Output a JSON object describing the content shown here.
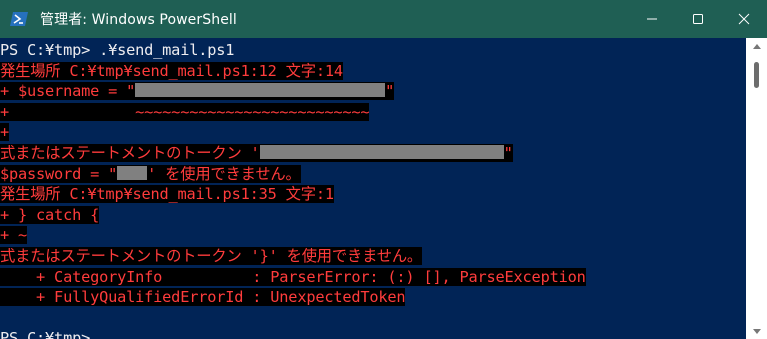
{
  "window": {
    "title": "管理者: Windows PowerShell",
    "icon": "powershell-icon",
    "controls": [
      "minimize-icon",
      "maximize-icon",
      "close-icon"
    ],
    "colors": {
      "titlebar": "#1f5f54",
      "console_bg": "#012456",
      "error_text": "#ff3c3c",
      "error_bg": "#000000"
    }
  },
  "console": {
    "prompt1": "PS C:¥tmp> ",
    "command1": ".¥send_mail.ps1",
    "err1_location": "発生場所 C:¥tmp¥send_mail.ps1:12 文字:14",
    "err1_code_prefix": "+ $username = \"",
    "err1_code_suffix": "\"",
    "err1_squiggle": "+              ~~~~~~~~~~~~~~~~~~~~~~~~~~",
    "err1_blank": "+",
    "err1_msg_prefix": "式またはステートメントのトークン '",
    "err1_msg_suffix": "\"",
    "err1_line2_prefix": "$password = \"",
    "err1_line2_suffix": "' を使用できません。",
    "err2_location": "発生場所 C:¥tmp¥send_mail.ps1:35 文字:1",
    "err2_code": "+ } catch {",
    "err2_squiggle": "+ ~",
    "err2_msg": "式またはステートメントのトークン '}' を使用できません。",
    "category": "    + CategoryInfo          : ParserError: (:) [], ParseException",
    "errorid": "    + FullyQualifiedErrorId : UnexpectedToken",
    "prompt2": "PS C:¥tmp> "
  }
}
